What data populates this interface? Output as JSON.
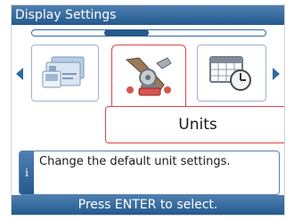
{
  "window": {
    "title": "Display Settings"
  },
  "carousel": {
    "selected_index": 1,
    "scroll_position": 0.38,
    "items": [
      {
        "icon": "network-cards-icon"
      },
      {
        "icon": "units-tools-icon"
      },
      {
        "icon": "date-time-grid-icon"
      }
    ]
  },
  "selection": {
    "label": "Units"
  },
  "info": {
    "badge": "i",
    "text": "Change the default unit settings."
  },
  "footer": {
    "hint": "Press ENTER to select."
  },
  "colors": {
    "accent": "#245a8e",
    "selection_border": "#d9474b"
  }
}
